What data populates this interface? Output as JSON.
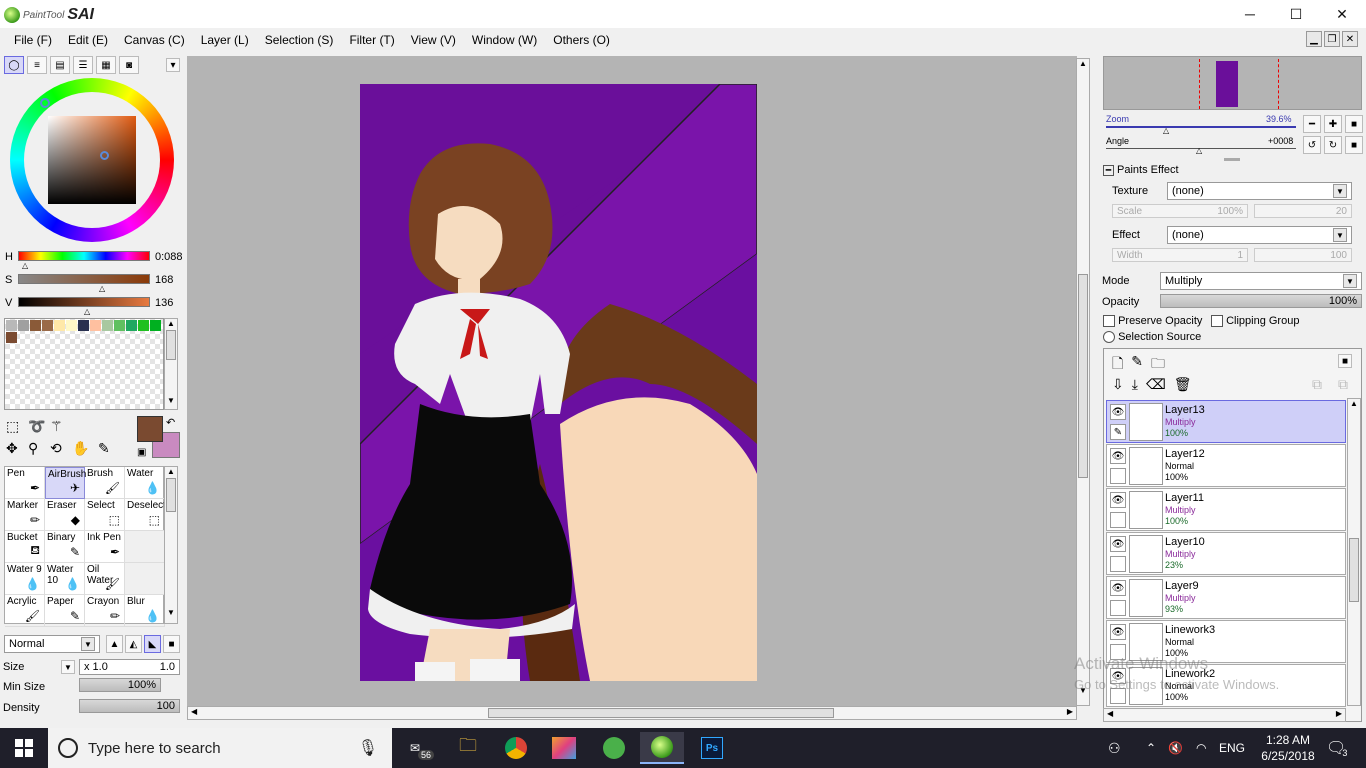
{
  "app": {
    "title_small": "PaintTool",
    "title_big": "SAI"
  },
  "window_controls": {
    "minimize": "─",
    "maximize": "☐",
    "close": "✕"
  },
  "menu": [
    "File (F)",
    "Edit (E)",
    "Canvas (C)",
    "Layer (L)",
    "Selection (S)",
    "Filter (T)",
    "View (V)",
    "Window (W)",
    "Others (O)"
  ],
  "color": {
    "h_label": "H",
    "h_value": "0:088",
    "s_label": "S",
    "s_value": "168",
    "v_label": "V",
    "v_value": "136",
    "primary": "#7a4a30",
    "secondary": "#c98ac0"
  },
  "swatches": [
    "#b8b8b8",
    "#a0a0a0",
    "#8a5a38",
    "#9a6a48",
    "#ffe8a8",
    "#fff8c8",
    "#283050",
    "#ffc0a0",
    "#a8c8a0",
    "#60c060",
    "#20a860",
    "#20c020",
    "#00b020",
    "#7a4a30"
  ],
  "tools": [
    {
      "label": "Pen",
      "icon": "pen"
    },
    {
      "label": "AirBrush",
      "icon": "airbrush",
      "selected": true
    },
    {
      "label": "Brush",
      "icon": "brush"
    },
    {
      "label": "Water",
      "icon": "water"
    },
    {
      "label": "Marker",
      "icon": "marker"
    },
    {
      "label": "Eraser",
      "icon": "eraser"
    },
    {
      "label": "Select",
      "icon": "select"
    },
    {
      "label": "Deselect",
      "icon": "deselect"
    },
    {
      "label": "Bucket",
      "icon": "bucket"
    },
    {
      "label": "Binary",
      "icon": "binary"
    },
    {
      "label": "Ink Pen",
      "icon": "ink-pen"
    },
    {
      "label": "",
      "icon": ""
    },
    {
      "label": "Water 9",
      "icon": "water"
    },
    {
      "label": "Water 10",
      "icon": "water"
    },
    {
      "label": "Oil Water",
      "icon": "oil"
    },
    {
      "label": "",
      "icon": ""
    },
    {
      "label": "Acrylic",
      "icon": "acrylic"
    },
    {
      "label": "Paper",
      "icon": "paper"
    },
    {
      "label": "Crayon",
      "icon": "crayon"
    },
    {
      "label": "Blur",
      "icon": "blur"
    }
  ],
  "brush": {
    "blend_mode": "Normal",
    "size_label": "Size",
    "size_mult": "x 1.0",
    "size_value": "1.0",
    "min_size_label": "Min Size",
    "min_size_value": "100%",
    "density_label": "Density",
    "density_value": "100"
  },
  "navigator": {
    "zoom_label": "Zoom",
    "zoom_value": "39.6%",
    "angle_label": "Angle",
    "angle_value": "+0008"
  },
  "paints_effect": {
    "header": "Paints Effect",
    "texture_label": "Texture",
    "texture_value": "(none)",
    "scale_label": "Scale",
    "scale_value": "100%",
    "scale_num": "20",
    "effect_label": "Effect",
    "effect_value": "(none)",
    "width_label": "Width",
    "width_value": "1",
    "width_num": "100"
  },
  "layer_props": {
    "mode_label": "Mode",
    "mode_value": "Multiply",
    "opacity_label": "Opacity",
    "opacity_value": "100%",
    "preserve_opacity": "Preserve Opacity",
    "clipping_group": "Clipping Group",
    "selection_source": "Selection Source"
  },
  "layers": [
    {
      "name": "Layer13",
      "mode": "Multiply",
      "opacity": "100%",
      "selected": true
    },
    {
      "name": "Layer12",
      "mode": "Normal",
      "opacity": "100%"
    },
    {
      "name": "Layer11",
      "mode": "Multiply",
      "opacity": "100%"
    },
    {
      "name": "Layer10",
      "mode": "Multiply",
      "opacity": "23%"
    },
    {
      "name": "Layer9",
      "mode": "Multiply",
      "opacity": "93%"
    },
    {
      "name": "Linework3",
      "mode": "Normal",
      "opacity": "100%"
    },
    {
      "name": "Linework2",
      "mode": "Normal",
      "opacity": "100%"
    }
  ],
  "watermark": {
    "line1": "Activate Windows",
    "line2": "Go to Settings to activate Windows."
  },
  "taskbar": {
    "search_placeholder": "Type here to search",
    "mail_badge": "56",
    "lang": "ENG",
    "time": "1:28 AM",
    "date": "6/25/2018",
    "notif_count": "3",
    "ps_label": "Ps"
  }
}
